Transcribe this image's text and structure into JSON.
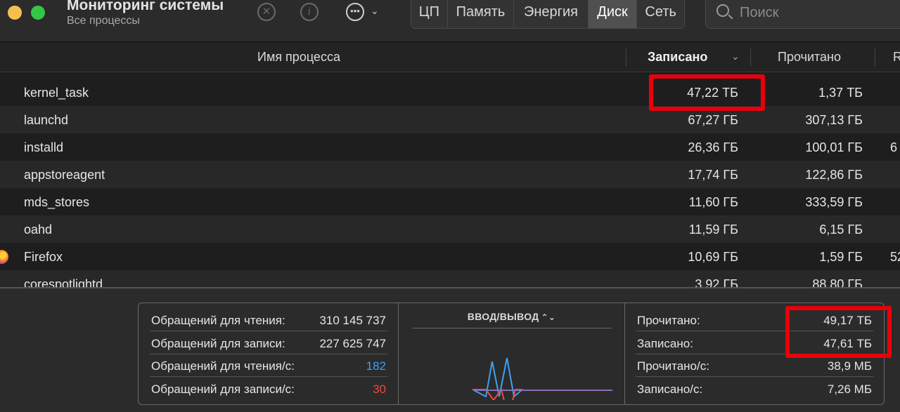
{
  "window": {
    "title": "Мониторинг системы",
    "subtitle": "Все процессы"
  },
  "toolbar": {
    "stop_icon": "x-circle-icon",
    "info_icon": "info-icon",
    "more_icon": "ellipsis-circle-icon",
    "more_glyph": "•••",
    "chevron_glyph": "⌄",
    "info_glyph": "i",
    "stop_glyph": "✕",
    "tabs": [
      {
        "label": "ЦП",
        "active": false
      },
      {
        "label": "Память",
        "active": false
      },
      {
        "label": "Энергия",
        "active": false
      },
      {
        "label": "Диск",
        "active": true
      },
      {
        "label": "Сеть",
        "active": false
      }
    ],
    "search_placeholder": "Поиск"
  },
  "table": {
    "columns": {
      "name": "Имя процесса",
      "written": "Записано",
      "read": "Прочитано",
      "next": "R"
    },
    "sort_glyph": "⌄",
    "rows": [
      {
        "name": "kernel_task",
        "written": "47,22 ТБ",
        "read": "1,37 ТБ",
        "extra": ""
      },
      {
        "name": "launchd",
        "written": "67,27 ГБ",
        "read": "307,13 ГБ",
        "extra": ""
      },
      {
        "name": "installd",
        "written": "26,36 ГБ",
        "read": "100,01 ГБ",
        "extra": "6"
      },
      {
        "name": "appstoreagent",
        "written": "17,74 ГБ",
        "read": "122,86 ГБ",
        "extra": ""
      },
      {
        "name": "mds_stores",
        "written": "11,60 ГБ",
        "read": "333,59 ГБ",
        "extra": ""
      },
      {
        "name": "oahd",
        "written": "11,59 ГБ",
        "read": "6,15 ГБ",
        "extra": ""
      },
      {
        "name": "Firefox",
        "written": "10,69 ГБ",
        "read": "1,59 ГБ",
        "extra": "52"
      },
      {
        "name": "corespotlightd",
        "written": "3,92 ГБ",
        "read": "88,80 ГБ",
        "extra": ""
      }
    ]
  },
  "stats": {
    "left": [
      {
        "label": "Обращений для чтения:",
        "value": "310 145 737"
      },
      {
        "label": "Обращений для записи:",
        "value": "227 625 747"
      },
      {
        "label": "Обращений для чтения/с:",
        "value": "182"
      },
      {
        "label": "Обращений для записи/с:",
        "value": "30"
      }
    ],
    "graph_title": "ВВОД/ВЫВОД",
    "graph_toggle_glyph": "⌃⌄",
    "right": [
      {
        "label": "Прочитано:",
        "value": "49,17 ТБ"
      },
      {
        "label": "Записано:",
        "value": "47,61 ТБ"
      },
      {
        "label": "Прочитано/с:",
        "value": "38,9 МБ"
      },
      {
        "label": "Записано/с:",
        "value": "7,26 МБ"
      }
    ]
  },
  "colors": {
    "read_series": "#3da0f5",
    "write_series": "#f0483e",
    "highlight": "#e8000b"
  }
}
